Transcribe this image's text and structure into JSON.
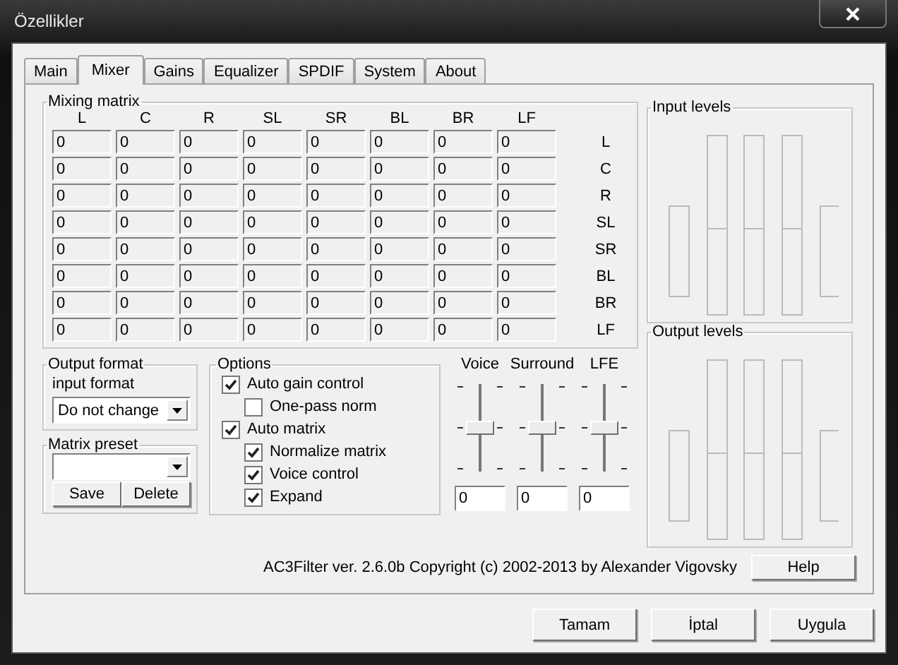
{
  "window": {
    "title": "Özellikler"
  },
  "tabs": [
    {
      "label": "Main",
      "selected": false
    },
    {
      "label": "Mixer",
      "selected": true
    },
    {
      "label": "Gains",
      "selected": false
    },
    {
      "label": "Equalizer",
      "selected": false
    },
    {
      "label": "SPDIF",
      "selected": false
    },
    {
      "label": "System",
      "selected": false
    },
    {
      "label": "About",
      "selected": false
    }
  ],
  "mixing_matrix": {
    "title": "Mixing matrix",
    "columns": [
      "L",
      "C",
      "R",
      "SL",
      "SR",
      "BL",
      "BR",
      "LF"
    ],
    "rows": [
      {
        "label": "L",
        "values": [
          "0",
          "0",
          "0",
          "0",
          "0",
          "0",
          "0",
          "0"
        ]
      },
      {
        "label": "C",
        "values": [
          "0",
          "0",
          "0",
          "0",
          "0",
          "0",
          "0",
          "0"
        ]
      },
      {
        "label": "R",
        "values": [
          "0",
          "0",
          "0",
          "0",
          "0",
          "0",
          "0",
          "0"
        ]
      },
      {
        "label": "SL",
        "values": [
          "0",
          "0",
          "0",
          "0",
          "0",
          "0",
          "0",
          "0"
        ]
      },
      {
        "label": "SR",
        "values": [
          "0",
          "0",
          "0",
          "0",
          "0",
          "0",
          "0",
          "0"
        ]
      },
      {
        "label": "BL",
        "values": [
          "0",
          "0",
          "0",
          "0",
          "0",
          "0",
          "0",
          "0"
        ]
      },
      {
        "label": "BR",
        "values": [
          "0",
          "0",
          "0",
          "0",
          "0",
          "0",
          "0",
          "0"
        ]
      },
      {
        "label": "LF",
        "values": [
          "0",
          "0",
          "0",
          "0",
          "0",
          "0",
          "0",
          "0"
        ]
      }
    ]
  },
  "output_format": {
    "title": "Output format",
    "label": "input format",
    "value": "Do not change"
  },
  "matrix_preset": {
    "title": "Matrix preset",
    "buttons": [
      "Save",
      "Delete"
    ]
  },
  "options": {
    "title": "Options",
    "items": [
      {
        "label": "Auto gain control",
        "checked": true,
        "children": [
          {
            "label": "One-pass norm",
            "checked": false
          }
        ]
      },
      {
        "label": "Auto matrix",
        "checked": true,
        "children": [
          {
            "label": "Normalize matrix",
            "checked": true
          },
          {
            "label": "Voice control",
            "checked": true
          },
          {
            "label": "Expand",
            "checked": true
          }
        ]
      }
    ]
  },
  "sliders": [
    {
      "label": "Voice",
      "level": 0.5,
      "value": "0"
    },
    {
      "label": "Surround",
      "level": 0.5,
      "value": "0"
    },
    {
      "label": "LFE",
      "level": 0.5,
      "value": "0"
    }
  ],
  "input_levels": {
    "title": "Input levels"
  },
  "output_levels": {
    "title": "Output levels"
  },
  "copyright": "AC3Filter ver. 2.6.0b Copyright (c) 2002-2013 by Alexander Vigovsky",
  "help_button": "Help",
  "buttons": [
    "Tamam",
    "İptal",
    "Uygula"
  ]
}
